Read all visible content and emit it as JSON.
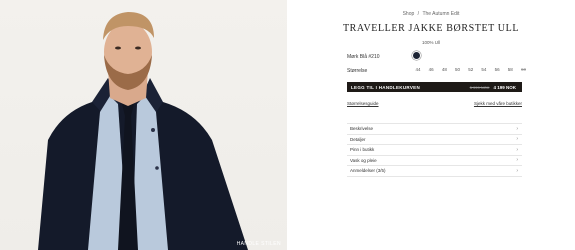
{
  "hero": {
    "overlay_label": "HANDLE STILEN"
  },
  "breadcrumb": [
    "Shop",
    "/",
    "The Autumn Edit"
  ],
  "product": {
    "title": "TRAVELLER JAKKE BØRSTET ULL",
    "material": "100% Ull",
    "color_label": "Mørk Blå #210",
    "color_hex": "#1c2333",
    "size_label": "Størrelse",
    "sizes": [
      {
        "label": "44",
        "available": true
      },
      {
        "label": "46",
        "available": true
      },
      {
        "label": "48",
        "available": true
      },
      {
        "label": "50",
        "available": true
      },
      {
        "label": "52",
        "available": true
      },
      {
        "label": "54",
        "available": true
      },
      {
        "label": "56",
        "available": true
      },
      {
        "label": "58",
        "available": true
      },
      {
        "label": "60",
        "available": false
      }
    ],
    "add_to_cart_label": "LEGG TIL I HANDLEKURVEN",
    "old_price": "5 999 NOK",
    "price": "4 199 NOK",
    "size_guide_label": "Størrelsesguide",
    "store_stock_label": "Sjekk med våre butikker"
  },
  "accordion": [
    {
      "label": "Beskrivelse"
    },
    {
      "label": "Detaljer"
    },
    {
      "label": "Pinn i butikk"
    },
    {
      "label": "Vask og pleie"
    },
    {
      "label": "Anmeldelser (3/5)"
    }
  ]
}
